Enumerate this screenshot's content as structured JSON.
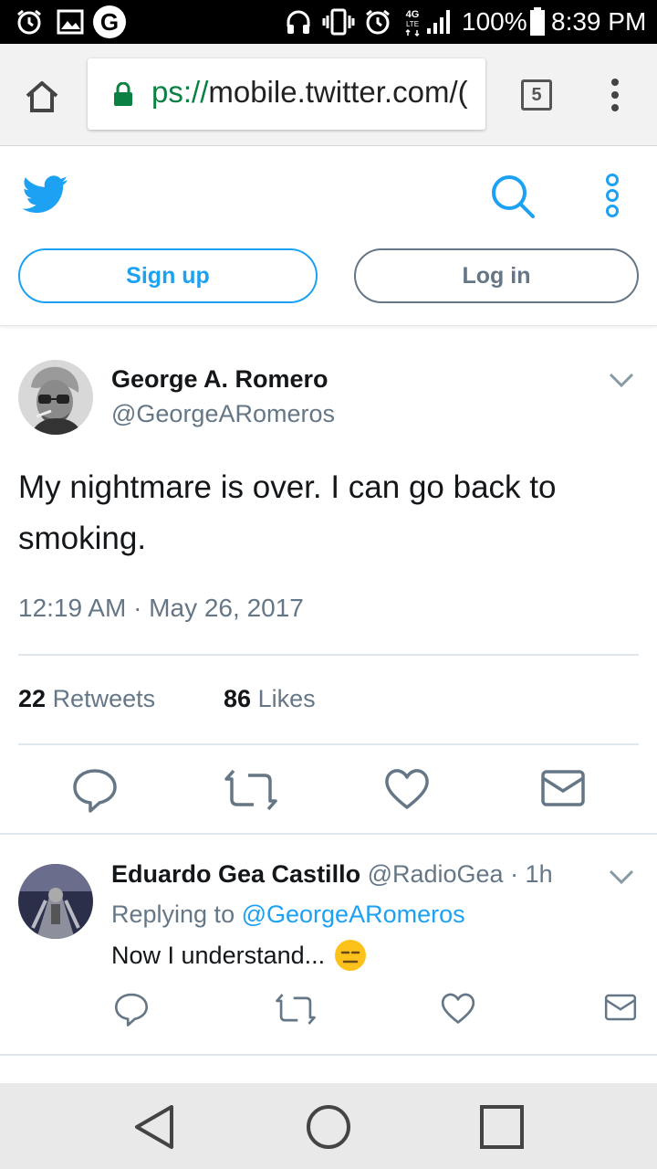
{
  "status_bar": {
    "battery": "100%",
    "time": "8:39 PM",
    "network": "4G LTE",
    "icons": [
      "alarm-icon",
      "image-icon",
      "google-icon",
      "headset-icon",
      "vibrate-icon",
      "alarm-icon",
      "signal-icon",
      "battery-icon"
    ]
  },
  "browser": {
    "url_scheme": "ps://",
    "url_rest": "mobile.twitter.com/(",
    "tab_count": "5",
    "colors": {
      "secure": "#0b8043"
    }
  },
  "header": {
    "signup_label": "Sign up",
    "login_label": "Log in",
    "colors": {
      "brand": "#1da1f2",
      "muted": "#657786"
    }
  },
  "tweet": {
    "name": "George A. Romero",
    "handle": "@GeorgeARomeros",
    "text": "My nightmare is over. I can go back to smoking.",
    "timestamp": "12:19 AM · May 26, 2017",
    "retweets_count": "22",
    "retweets_label": "Retweets",
    "likes_count": "86",
    "likes_label": "Likes"
  },
  "reply": {
    "name": "Eduardo Gea Castillo",
    "meta": "@RadioGea · 1h",
    "replying_prefix": "Replying to",
    "replying_to": "@GeorgeARomeros",
    "text": "Now I understand...",
    "emoji": "expressionless-face"
  }
}
